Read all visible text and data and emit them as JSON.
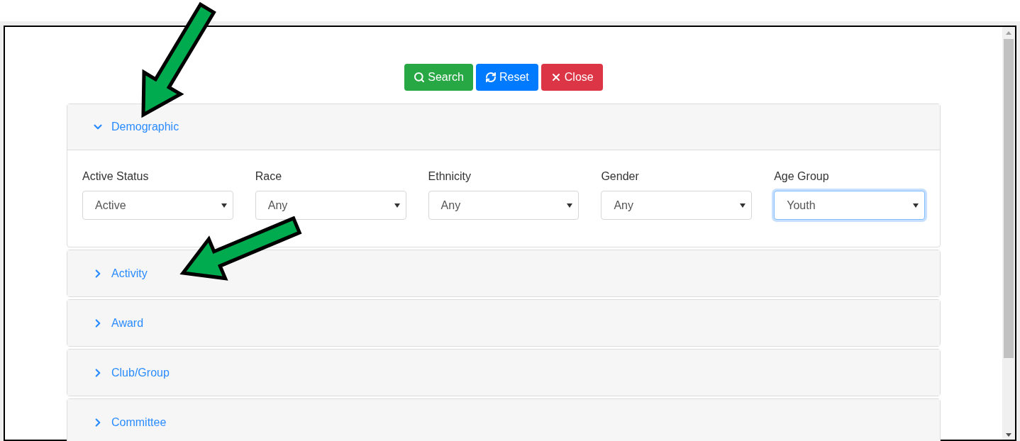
{
  "buttons": [
    {
      "kind": "search",
      "label": "Search"
    },
    {
      "kind": "reset",
      "label": "Reset"
    },
    {
      "kind": "close",
      "label": "Close"
    }
  ],
  "sections": [
    {
      "title": "Demographic",
      "expanded": true,
      "fields": [
        {
          "label": "Active Status",
          "value": "Active",
          "focused": false
        },
        {
          "label": "Race",
          "value": "Any",
          "focused": false
        },
        {
          "label": "Ethnicity",
          "value": "Any",
          "focused": false
        },
        {
          "label": "Gender",
          "value": "Any",
          "focused": false
        },
        {
          "label": "Age Group",
          "value": "Youth",
          "focused": true
        }
      ]
    },
    {
      "title": "Activity",
      "expanded": false
    },
    {
      "title": "Award",
      "expanded": false
    },
    {
      "title": "Club/Group",
      "expanded": false
    },
    {
      "title": "Committee",
      "expanded": false
    }
  ]
}
